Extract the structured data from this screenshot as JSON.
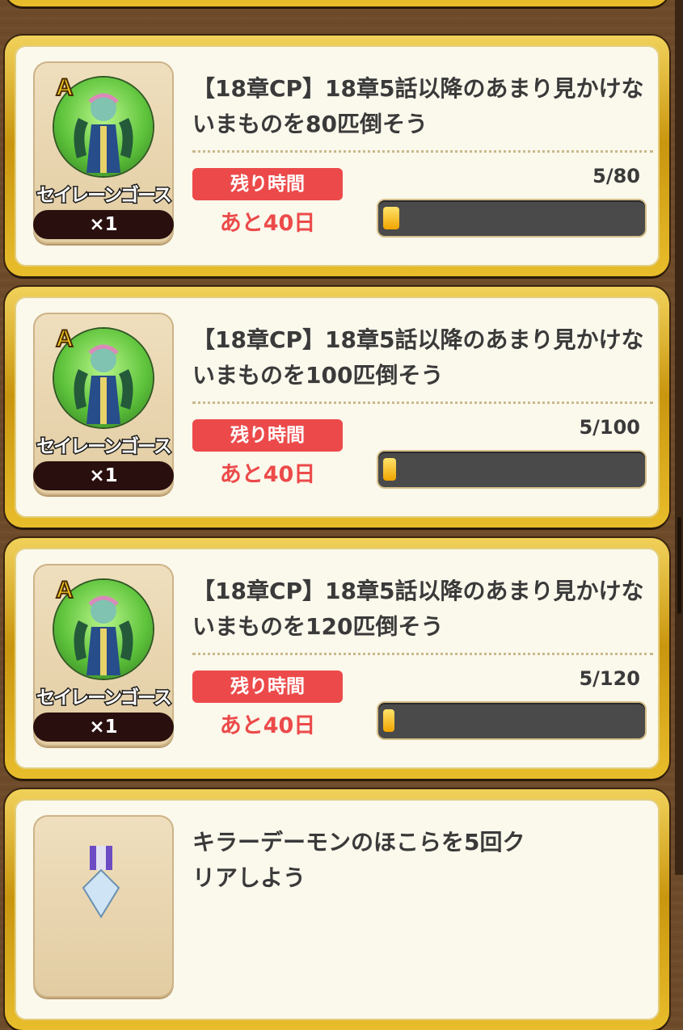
{
  "quests": [
    {
      "title": "【18章CP】18章5話以降のあまり見かけないまものを80匹倒そう",
      "timer_label": "残り時間",
      "remaining": "あと40日",
      "progress": "5/80",
      "progress_fraction": 0.0625,
      "reward": {
        "rank": "A",
        "name": "セイレーンゴースト",
        "qty": "×1",
        "icon": "monster-icon"
      }
    },
    {
      "title": "【18章CP】18章5話以降のあまり見かけないまものを100匹倒そう",
      "timer_label": "残り時間",
      "remaining": "あと40日",
      "progress": "5/100",
      "progress_fraction": 0.05,
      "reward": {
        "rank": "A",
        "name": "セイレーンゴースト",
        "qty": "×1",
        "icon": "monster-icon"
      }
    },
    {
      "title": "【18章CP】18章5話以降のあまり見かけないまものを120匹倒そう",
      "timer_label": "残り時間",
      "remaining": "あと40日",
      "progress": "5/120",
      "progress_fraction": 0.0417,
      "reward": {
        "rank": "A",
        "name": "セイレーンゴースト",
        "qty": "×1",
        "icon": "monster-icon"
      }
    },
    {
      "title": "キラーデーモンのほこらを5回クリアしよう",
      "reward": {
        "icon": "medal-icon"
      }
    }
  ],
  "colors": {
    "accent_red": "#ec4a4a",
    "gold_frame": "#e8bd2b",
    "card_bg": "#fbf8ec",
    "bar_fill": "#f0a400"
  }
}
